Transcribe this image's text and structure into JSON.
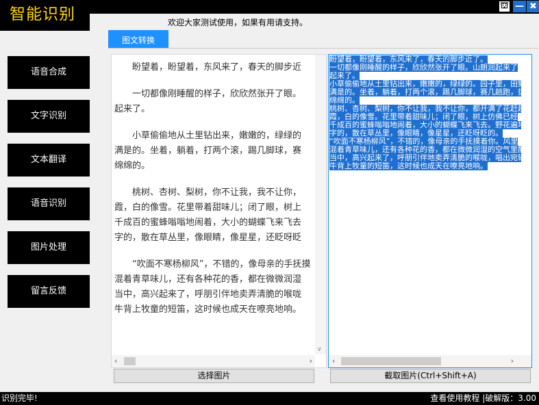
{
  "app": {
    "title": "智能识别",
    "welcome": "欢迎大家测试使用，如果有用请支持。"
  },
  "window": {
    "shirt_icon": "⛫",
    "min": "—",
    "close": "✖"
  },
  "tabs": [
    {
      "label": "图文转换",
      "active": true
    }
  ],
  "sidebar": {
    "items": [
      {
        "label": "语音合成"
      },
      {
        "label": "文字识别"
      },
      {
        "label": "文本翻译"
      },
      {
        "label": "语音识别"
      },
      {
        "label": "图片处理"
      },
      {
        "label": "留言反馈"
      }
    ]
  },
  "left_pane": {
    "paragraphs": [
      [
        "　　盼望着，盼望着，东风来了，春天的脚步近"
      ],
      [
        "　　一切都像刚睡醒的样子，欣欣然张开了眼。",
        "起来了。"
      ],
      [
        "　　小草偷偷地从土里钻出来，嫩嫩的，绿绿的",
        "满是的。坐着，躺着，打两个滚，踢几脚球，赛",
        "绵绵的。"
      ],
      [
        "　　桃树、杏树、梨树，你不让我，我不让你，",
        "霞，白的像雪。花里带着甜味儿；闭了眼，树上",
        "千成百的蜜蜂嗡嗡地闹着，大小的蝴蝶飞来飞去",
        "字的，散在草丛里，像眼睛，像星星，还眨呀眨"
      ],
      [
        "　　“吹面不寒杨柳风”，不错的，像母亲的手抚摸",
        "混着青草味儿，还有各种花的香，都在微微润湿",
        "当中，高兴起来了，呼朋引伴地卖弄清脆的喉咙",
        "牛背上牧童的短笛，这时候也成天在嘹亮地响。"
      ]
    ]
  },
  "right_pane": {
    "lines": [
      "盼望着，盼望着，东风来了，春天的脚步近了。",
      "一切都像刚睡醒的样子，欣欣然张开了眼。山朗润起来了",
      "起来了。",
      "小草偷偷地从土里钻出来，嫩嫩的，绿绿的。园子里，田野",
      "满是的。坐着，躺着，打两个滚，踢几脚球，赛几趟跑，捉几",
      "绵绵的。",
      "桃树、杏树、梨树，你不让我，我不让你，都开满了花赶趟",
      "霞，白的像雪。花里带着甜味儿；闭了眼，树上仿佛已经",
      "千成百的蜜蜂嗡嗡地闹着，大小的蝴蝶飞来飞去。野花遍地",
      "字的，散在草丛里，像眼睛，像星星，还眨呀眨的。",
      "“吹面不寒杨柳风”，不错的，像母亲的手抚摸着你。风里",
      "混着青草味儿，还有各种花的香，都在微微润湿的空气里酝酿",
      "当中，高兴起来了，呼朋引伴地卖弄清脆的喉咙，唱出宛转",
      "牛背上牧童的短笛，这时候也成天在嘹亮地响。"
    ]
  },
  "buttons": {
    "select_image": "选择图片",
    "capture_image": "截取图片(Ctrl+Shift+A)"
  },
  "status": {
    "left": "识别完毕!",
    "right": "查看使用教程 |破解版：3.00"
  },
  "colors": {
    "accent": "#1e90ff",
    "title": "#ffd400",
    "selection": "#1e6fd0"
  }
}
